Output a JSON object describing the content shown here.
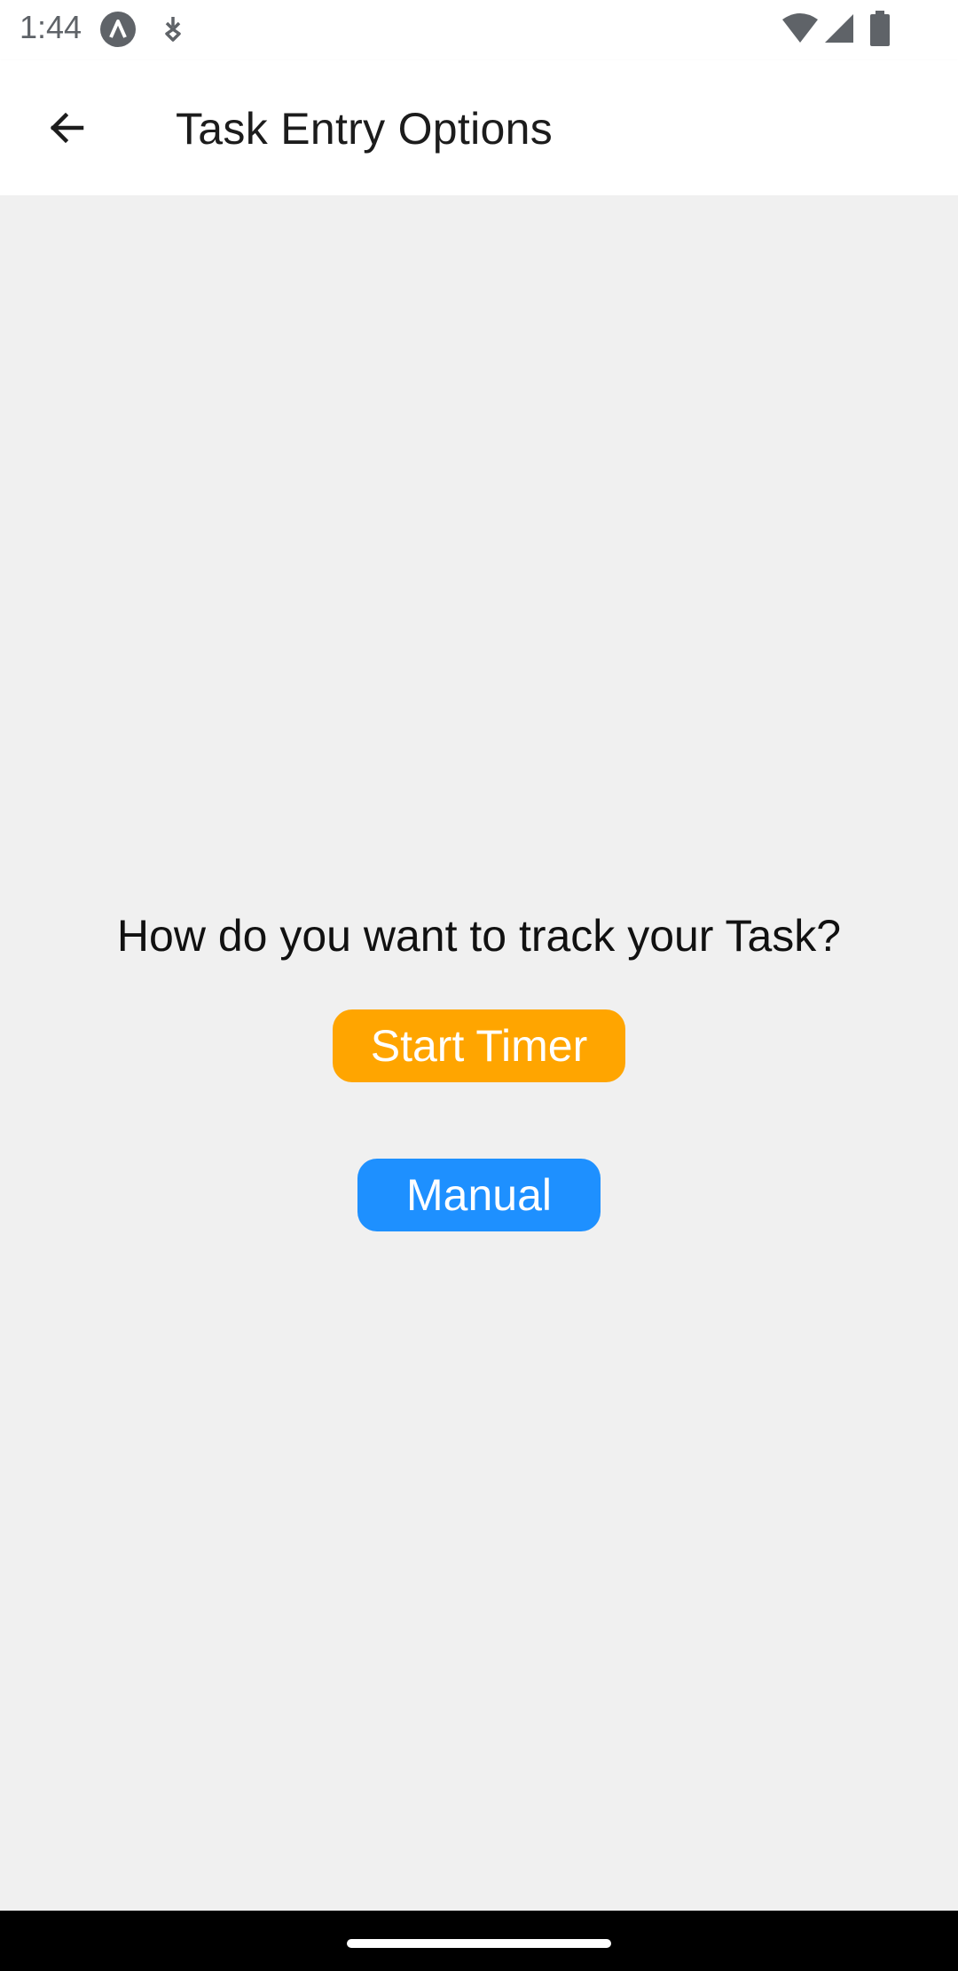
{
  "status_bar": {
    "time": "1:44",
    "icons": [
      "app-notification-icon",
      "download-indicator-icon",
      "wifi-icon",
      "cellular-signal-icon",
      "battery-icon"
    ]
  },
  "app_bar": {
    "back_icon": "arrow-back-icon",
    "title": "Task Entry Options"
  },
  "main": {
    "question": "How do you want to track your Task?",
    "start_timer_label": "Start Timer",
    "manual_label": "Manual"
  },
  "colors": {
    "start_timer_bg": "#ffa500",
    "manual_bg": "#1e90ff",
    "background": "#f0f0f0",
    "app_bar_bg": "#ffffff"
  }
}
